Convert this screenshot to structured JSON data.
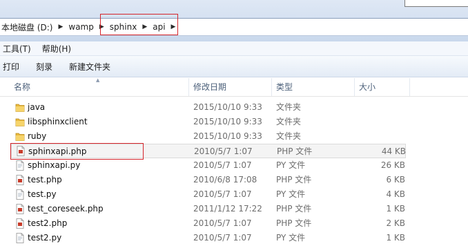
{
  "address": {
    "crumbs": [
      "本地磁盘 (D:)",
      "wamp",
      "sphinx",
      "api"
    ],
    "highlight_color": "#d4242a"
  },
  "menu": {
    "items": [
      "工具(T)",
      "帮助(H)"
    ]
  },
  "toolbar": {
    "items": [
      "打印",
      "刻录",
      "新建文件夹"
    ]
  },
  "columns": {
    "name": "名称",
    "date": "修改日期",
    "type": "类型",
    "size": "大小"
  },
  "files": [
    {
      "name": "java",
      "date": "2015/10/10 9:33",
      "type": "文件夹",
      "size": "",
      "icon": "folder-icon"
    },
    {
      "name": "libsphinxclient",
      "date": "2015/10/10 9:33",
      "type": "文件夹",
      "size": "",
      "icon": "folder-icon"
    },
    {
      "name": "ruby",
      "date": "2015/10/10 9:33",
      "type": "文件夹",
      "size": "",
      "icon": "folder-icon"
    },
    {
      "name": "sphinxapi.php",
      "date": "2010/5/7 1:07",
      "type": "PHP 文件",
      "size": "44 KB",
      "icon": "php-file-icon",
      "selected": true
    },
    {
      "name": "sphinxapi.py",
      "date": "2010/5/7 1:07",
      "type": "PY 文件",
      "size": "26 KB",
      "icon": "py-file-icon"
    },
    {
      "name": "test.php",
      "date": "2010/6/8 17:08",
      "type": "PHP 文件",
      "size": "6 KB",
      "icon": "php-file-icon"
    },
    {
      "name": "test.py",
      "date": "2010/5/7 1:07",
      "type": "PY 文件",
      "size": "4 KB",
      "icon": "py-file-icon"
    },
    {
      "name": "test_coreseek.php",
      "date": "2011/1/12 17:22",
      "type": "PHP 文件",
      "size": "1 KB",
      "icon": "php-file-icon"
    },
    {
      "name": "test2.php",
      "date": "2010/5/7 1:07",
      "type": "PHP 文件",
      "size": "2 KB",
      "icon": "php-file-icon"
    },
    {
      "name": "test2.py",
      "date": "2010/5/7 1:07",
      "type": "PY 文件",
      "size": "1 KB",
      "icon": "py-file-icon"
    }
  ]
}
